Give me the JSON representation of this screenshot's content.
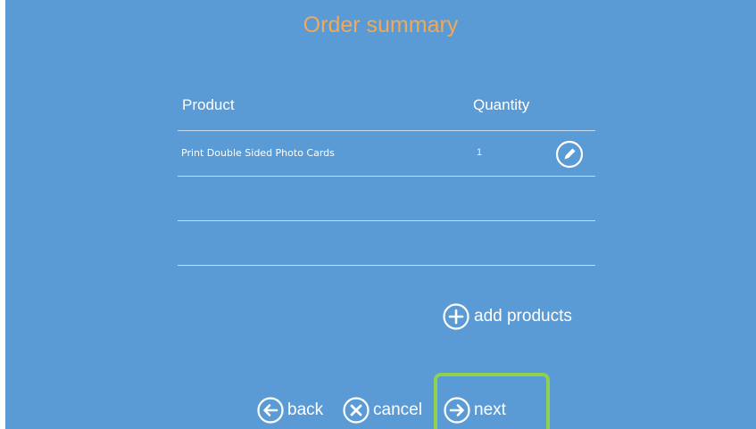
{
  "title": "Order summary",
  "table": {
    "headers": {
      "product": "Product",
      "quantity": "Quantity"
    },
    "rows": [
      {
        "product": "Print Double Sided Photo Cards",
        "quantity": "1"
      }
    ]
  },
  "actions": {
    "add_products": "add products",
    "back": "back",
    "cancel": "cancel",
    "next": "next"
  },
  "colors": {
    "background": "#5b9bd5",
    "title": "#f0a85a",
    "highlight": "#8fd14f"
  },
  "icons": {
    "edit": "pencil-icon",
    "add": "plus-circle-icon",
    "back": "arrow-left-circle-icon",
    "cancel": "x-circle-icon",
    "next": "arrow-right-circle-icon"
  }
}
